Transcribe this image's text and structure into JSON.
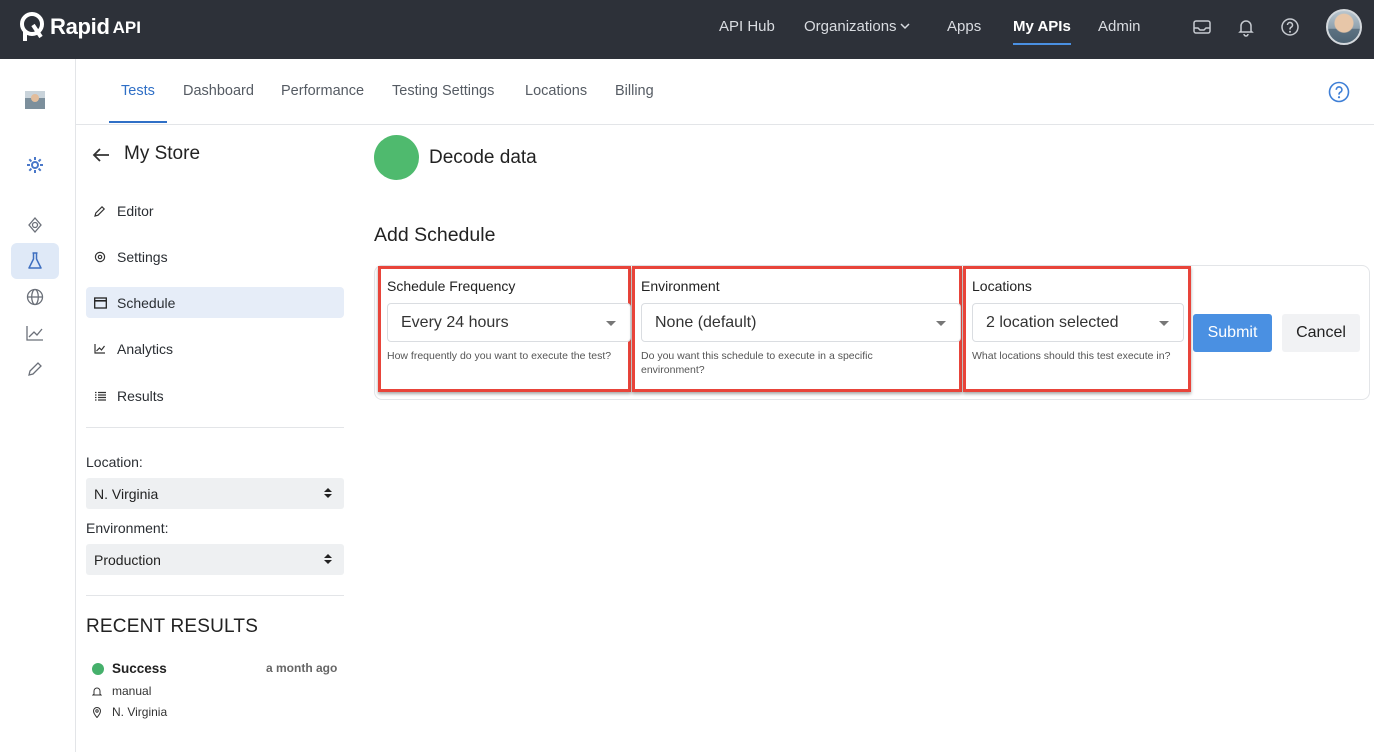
{
  "brand": {
    "name": "Rapid",
    "suffix": "API"
  },
  "topnav": {
    "items": [
      {
        "label": "API Hub"
      },
      {
        "label": "Organizations"
      },
      {
        "label": "Apps"
      },
      {
        "label": "My APIs"
      },
      {
        "label": "Admin"
      }
    ]
  },
  "rail": {
    "icons": [
      "avatar",
      "cog-icon",
      "radar-icon",
      "flask-icon",
      "globe-icon",
      "chart-icon",
      "pencil-icon"
    ]
  },
  "subnav": {
    "tabs": [
      {
        "label": "Tests"
      },
      {
        "label": "Dashboard"
      },
      {
        "label": "Performance"
      },
      {
        "label": "Testing Settings"
      },
      {
        "label": "Locations"
      },
      {
        "label": "Billing"
      }
    ]
  },
  "panel": {
    "title": "My Store",
    "menu": [
      {
        "label": "Editor",
        "icon": "pencil-icon"
      },
      {
        "label": "Settings",
        "icon": "settings-icon"
      },
      {
        "label": "Schedule",
        "icon": "calendar-icon"
      },
      {
        "label": "Analytics",
        "icon": "analytics-icon"
      },
      {
        "label": "Results",
        "icon": "list-icon"
      }
    ],
    "location_label": "Location:",
    "location_value": "N. Virginia",
    "environment_label": "Environment:",
    "environment_value": "Production",
    "recent_title": "RECENT RESULTS",
    "recent": {
      "status": "Success",
      "time": "a month ago",
      "trigger": "manual",
      "location": "N. Virginia"
    }
  },
  "main": {
    "test_name": "Decode data",
    "section_title": "Add Schedule",
    "fields": [
      {
        "label": "Schedule Frequency",
        "value": "Every 24 hours",
        "help": "How frequently do you want to execute the test?"
      },
      {
        "label": "Environment",
        "value": "None (default)",
        "help": "Do you want this schedule to execute in a specific environment?"
      },
      {
        "label": "Locations",
        "value": "2 location selected",
        "help": "What locations should this test execute in?"
      }
    ],
    "submit_label": "Submit",
    "cancel_label": "Cancel"
  },
  "colors": {
    "topbar": "#2d3139",
    "accent": "#4a90e2",
    "success": "#4fba6e",
    "highlight": "#e8443a"
  }
}
